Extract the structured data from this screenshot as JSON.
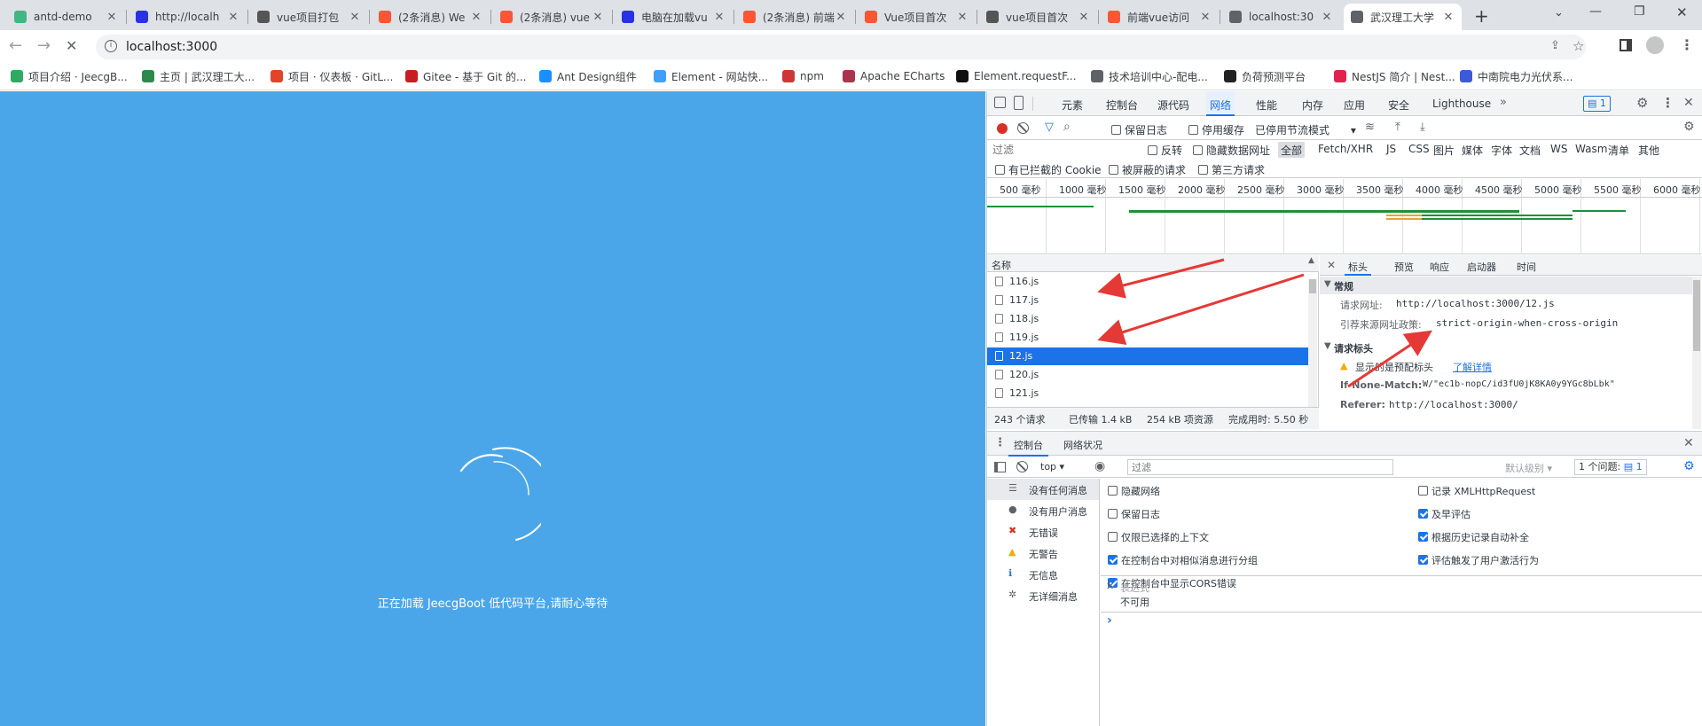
{
  "tabs": [
    {
      "title": "antd-demo",
      "fav": "#41b883"
    },
    {
      "title": "http://localh",
      "fav": "#2932e1"
    },
    {
      "title": "vue项目打包",
      "fav": "#555"
    },
    {
      "title": "(2条消息) We",
      "fav": "#fc5531"
    },
    {
      "title": "(2条消息) vue",
      "fav": "#fc5531"
    },
    {
      "title": "电脑在加载vu",
      "fav": "#2932e1"
    },
    {
      "title": "(2条消息) 前端",
      "fav": "#fc5531"
    },
    {
      "title": "Vue项目首次",
      "fav": "#fc5531"
    },
    {
      "title": "vue项目首次",
      "fav": "#555"
    },
    {
      "title": "前端vue访问",
      "fav": "#fc5531"
    },
    {
      "title": "localhost:30",
      "fav": "#5f6368"
    },
    {
      "title": "武汉理工大学",
      "fav": "#5f6368"
    }
  ],
  "address": {
    "url": "localhost:3000"
  },
  "bookmarks": [
    {
      "label": "项目介绍 · JeecgB...",
      "color": "#2eaa63"
    },
    {
      "label": "主页 | 武汉理工大...",
      "color": "#2d8a4b"
    },
    {
      "label": "项目 · 仪表板 · GitL...",
      "color": "#e24329"
    },
    {
      "label": "Gitee - 基于 Git 的...",
      "color": "#c71d23"
    },
    {
      "label": "Ant Design组件",
      "color": "#1890ff"
    },
    {
      "label": "Element - 网站快...",
      "color": "#409eff"
    },
    {
      "label": "npm",
      "color": "#cb3837"
    },
    {
      "label": "Apache ECharts",
      "color": "#aa344d"
    },
    {
      "label": "Element.requestF...",
      "color": "#111"
    },
    {
      "label": "技术培训中心-配电...",
      "color": "#5f6368"
    },
    {
      "label": "负荷预测平台",
      "color": "#222"
    },
    {
      "label": "NestJS 简介 | Nest...",
      "color": "#e0234e"
    },
    {
      "label": "中南院电力光伏系...",
      "color": "#3b5bdb"
    }
  ],
  "page": {
    "loading_text": "正在加载 JeecgBoot 低代码平台,请耐心等待",
    "bg": "#4aa6e9"
  },
  "devtools": {
    "tabs": [
      "元素",
      "控制台",
      "源代码",
      "网络",
      "性能",
      "内存",
      "应用",
      "安全",
      "Lighthouse"
    ],
    "active_tab": "网络",
    "issues_count": "1",
    "net_toolbar": {
      "preserve_log": "保留日志",
      "disable_cache": "停用缓存",
      "throttle": "已停用节流模式"
    },
    "filter": {
      "placeholder": "过滤",
      "invert": "反转",
      "hide_data_urls": "隐藏数据网址",
      "types": [
        "全部",
        "Fetch/XHR",
        "JS",
        "CSS",
        "图片",
        "媒体",
        "字体",
        "文档",
        "WS",
        "Wasm",
        "清单",
        "其他"
      ],
      "active_type": "全部"
    },
    "filter2": {
      "blocked_cookies": "有已拦截的 Cookie",
      "blocked_requests": "被屏蔽的请求",
      "third_party": "第三方请求"
    },
    "timeline_ticks": [
      "500 毫秒",
      "1000 毫秒",
      "1500 毫秒",
      "2000 毫秒",
      "2500 毫秒",
      "3000 毫秒",
      "3500 毫秒",
      "4000 毫秒",
      "4500 毫秒",
      "5000 毫秒",
      "5500 毫秒",
      "6000 毫秒"
    ],
    "list_header": "名称",
    "requests": [
      "116.js",
      "117.js",
      "118.js",
      "119.js",
      "12.js",
      "120.js",
      "121.js"
    ],
    "selected_request": "12.js",
    "status": {
      "requests": "243 个请求",
      "transferred": "已传输 1.4 kB",
      "resources": "254 kB 项资源",
      "finish": "完成用时: 5.50 秒"
    },
    "detail_tabs": [
      "标头",
      "预览",
      "响应",
      "启动器",
      "时间"
    ],
    "active_detail_tab": "标头",
    "general": {
      "title": "常规",
      "url_label": "请求网址:",
      "url_value": "http://localhost:3000/12.js",
      "policy_label": "引荐来源网址政策:",
      "policy_value": "strict-origin-when-cross-origin"
    },
    "req_headers": {
      "title": "请求标头",
      "provisional": "显示的是预配标头",
      "learn_more": "了解详情",
      "if_none_match_label": "If-None-Match:",
      "if_none_match_value": "W/\"ec1b-nopC/id3fU0jK8KA0y9YGc8bLbk\"",
      "referer_label": "Referer:",
      "referer_value": "http://localhost:3000/"
    },
    "drawer": {
      "tabs": [
        "控制台",
        "网络状况"
      ],
      "active": "控制台",
      "context": "top",
      "filter_placeholder": "过滤",
      "level": "默认级别",
      "issues": "1 个问题:",
      "issues_count": "1"
    },
    "sidebar": [
      {
        "label": "没有任何消息",
        "icon": "list-icon"
      },
      {
        "label": "没有用户消息",
        "icon": "user-icon"
      },
      {
        "label": "无错误",
        "icon": "error-icon"
      },
      {
        "label": "无警告",
        "icon": "warning-icon"
      },
      {
        "label": "无信息",
        "icon": "info-icon"
      },
      {
        "label": "无详细消息",
        "icon": "gear-icon"
      }
    ],
    "settings_left": [
      {
        "label": "隐藏网络",
        "checked": false
      },
      {
        "label": "保留日志",
        "checked": false
      },
      {
        "label": "仅限已选择的上下文",
        "checked": false
      },
      {
        "label": "在控制台中对相似消息进行分组",
        "checked": true
      },
      {
        "label": "在控制台中显示CORS错误",
        "checked": true
      }
    ],
    "settings_right": [
      {
        "label": "记录 XMLHttpRequest",
        "checked": false
      },
      {
        "label": "及早评估",
        "checked": true
      },
      {
        "label": "根据历史记录自动补全",
        "checked": true
      },
      {
        "label": "评估触发了用户激活行为",
        "checked": true
      }
    ],
    "expression": {
      "label": "表达式",
      "value": "不可用"
    },
    "prompt": "›"
  }
}
